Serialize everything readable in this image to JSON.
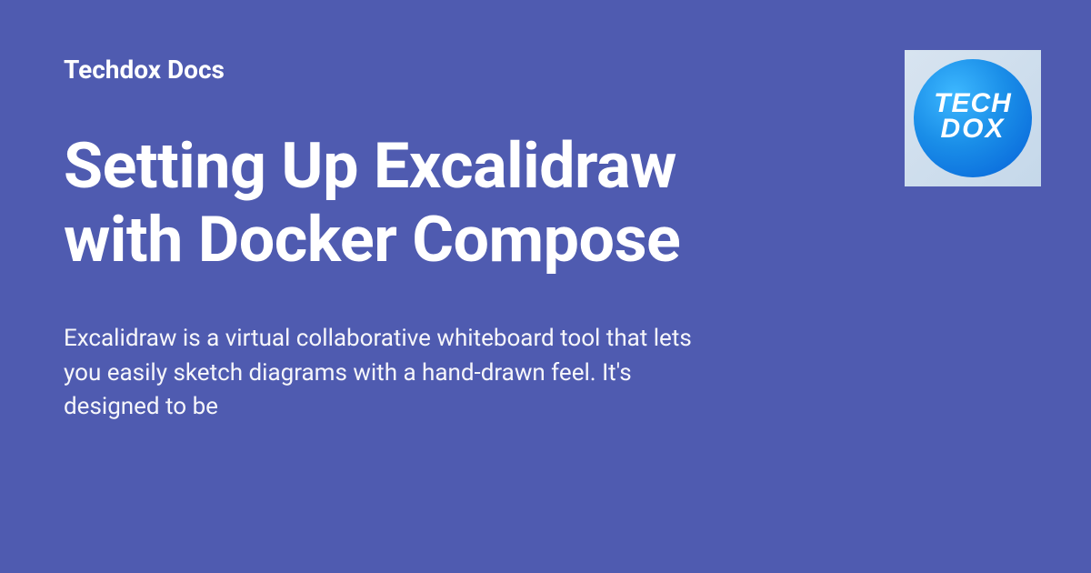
{
  "site_name": "Techdox Docs",
  "page_title": "Setting Up Excalidraw with Docker Compose",
  "description": "Excalidraw is a virtual collaborative whiteboard tool that lets you easily sketch diagrams with a hand-drawn feel. It's designed to be",
  "logo": {
    "line1": "TECH",
    "line2": "DOX"
  }
}
